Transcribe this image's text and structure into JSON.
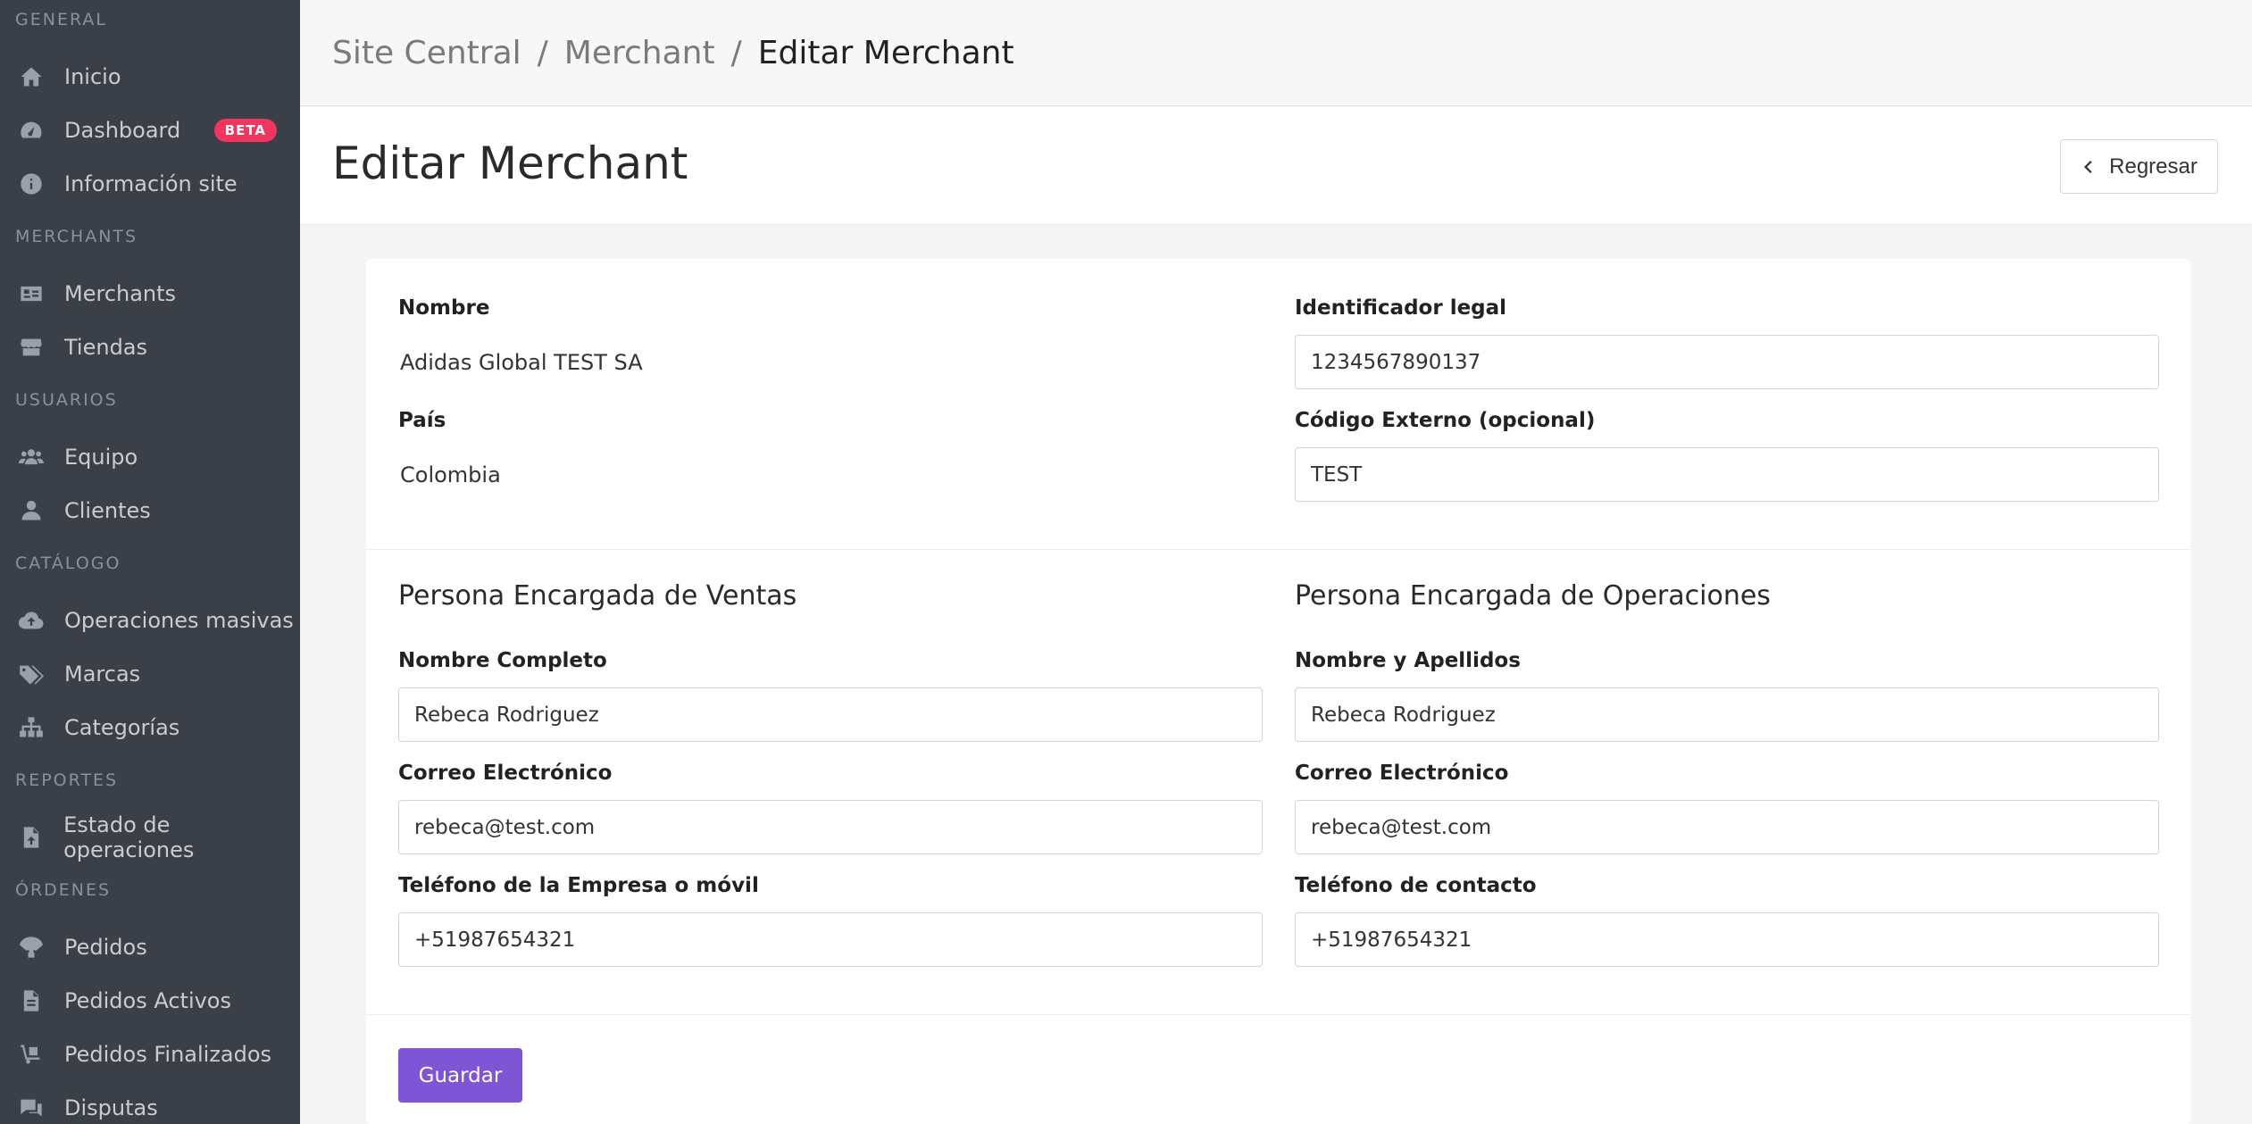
{
  "sidebar": {
    "sections": {
      "general": "GENERAL",
      "merchants": "MERCHANTS",
      "usuarios": "USUARIOS",
      "catalogo": "CATÁLOGO",
      "reportes": "REPORTES",
      "ordenes": "ÓRDENES"
    },
    "items": {
      "inicio": "Inicio",
      "dashboard": "Dashboard",
      "dashboard_badge": "BETA",
      "info_site": "Información site",
      "merchants": "Merchants",
      "tiendas": "Tiendas",
      "equipo": "Equipo",
      "clientes": "Clientes",
      "operaciones_masivas": "Operaciones masivas",
      "marcas": "Marcas",
      "categorias": "Categorías",
      "estado_operaciones": "Estado de operaciones",
      "pedidos": "Pedidos",
      "pedidos_activos": "Pedidos Activos",
      "pedidos_finalizados": "Pedidos Finalizados",
      "disputas": "Disputas"
    }
  },
  "breadcrumb": {
    "items": [
      "Site Central",
      "Merchant",
      "Editar Merchant"
    ],
    "separator": "/"
  },
  "page": {
    "title": "Editar Merchant",
    "back_label": "Regresar"
  },
  "form": {
    "nombre_label": "Nombre",
    "nombre_value": "Adidas Global TEST SA",
    "pais_label": "País",
    "pais_value": "Colombia",
    "identificador_label": "Identificador legal",
    "identificador_value": "1234567890137",
    "codigo_label": "Código Externo (opcional)",
    "codigo_value": "TEST",
    "ventas": {
      "heading": "Persona Encargada de Ventas",
      "nombre_label": "Nombre Completo",
      "nombre_value": "Rebeca Rodriguez",
      "correo_label": "Correo Electrónico",
      "correo_value": "rebeca@test.com",
      "telefono_label": "Teléfono de la Empresa o móvil",
      "telefono_value": "+51987654321"
    },
    "operaciones": {
      "heading": "Persona Encargada de Operaciones",
      "nombre_label": "Nombre y Apellidos",
      "nombre_value": "Rebeca Rodriguez",
      "correo_label": "Correo Electrónico",
      "correo_value": "rebeca@test.com",
      "telefono_label": "Teléfono de contacto",
      "telefono_value": "+51987654321"
    },
    "save_label": "Guardar"
  },
  "colors": {
    "sidebar_bg": "#3a3f48",
    "primary": "#7e55d4",
    "badge": "#f0365f"
  }
}
